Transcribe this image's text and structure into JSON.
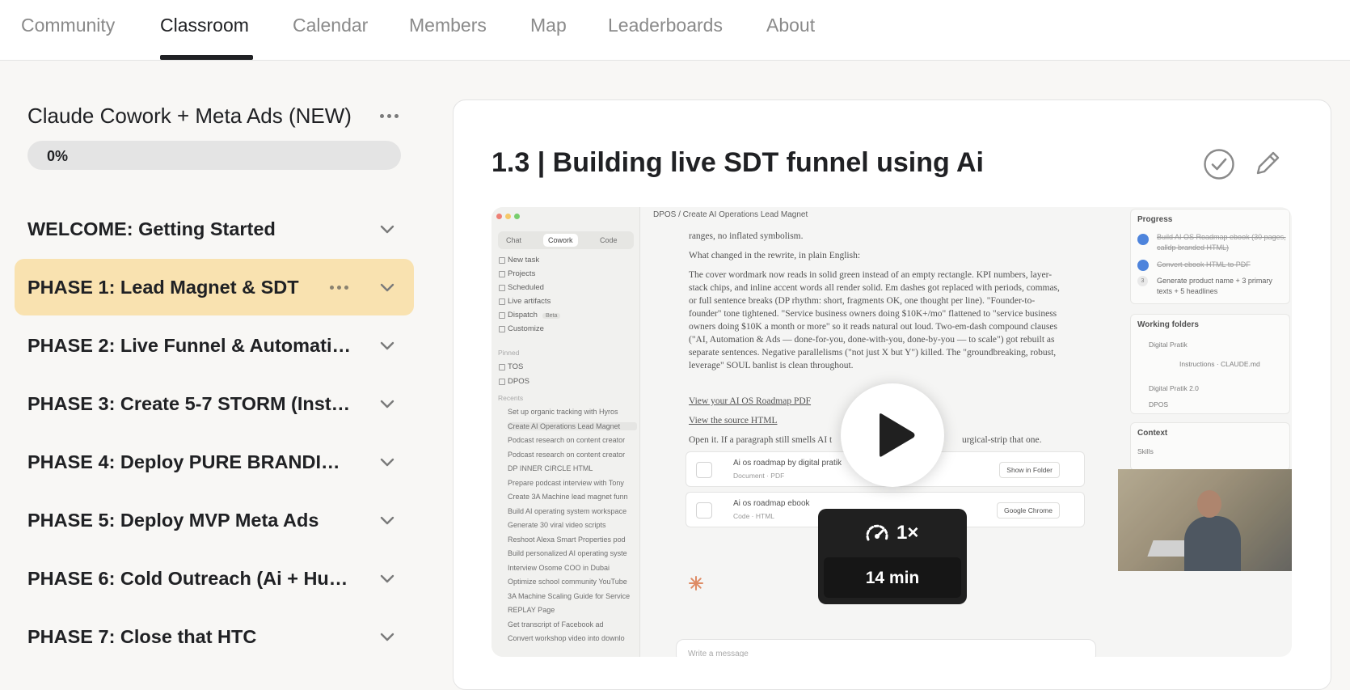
{
  "nav": {
    "tabs": [
      "Community",
      "Classroom",
      "Calendar",
      "Members",
      "Map",
      "Leaderboards",
      "About"
    ],
    "active": "Classroom"
  },
  "sidebar": {
    "course_title": "Claude Cowork + Meta Ads (NEW)",
    "progress_text": "0%",
    "progress_value": 0,
    "phases": [
      "WELCOME: Getting Started",
      "PHASE 1: Lead Magnet & SDT",
      "PHASE 2: Live Funnel & Automations",
      "PHASE 3: Create 5-7 STORM (Insta...",
      "PHASE 4: Deploy PURE BRANDING ...",
      "PHASE 5: Deploy MVP Meta Ads",
      "PHASE 6: Cold Outreach (Ai + Hum...",
      "PHASE 7: Close that HTC"
    ],
    "active_phase_index": 1
  },
  "lesson": {
    "title": "1.3 | Building live SDT funnel using Ai"
  },
  "video": {
    "speed": "1×",
    "duration": "14 min",
    "app": {
      "segments": [
        "Chat",
        "Cowork",
        "Code"
      ],
      "menu": [
        "New task",
        "Projects",
        "Scheduled",
        "Live artifacts",
        "Dispatch",
        "Customize"
      ],
      "beta": "Beta",
      "pinned_label": "Pinned",
      "pinned": [
        "TOS",
        "DPOS"
      ],
      "recents_label": "Recents",
      "recents": [
        "Set up organic tracking with Hyros",
        "Create AI Operations Lead Magnet",
        "Podcast research on content creator",
        "Podcast research on content creator",
        "DP INNER CIRCLE HTML",
        "Prepare podcast interview with Tony",
        "Create 3A Machine lead magnet funn",
        "Build AI operating system workspace",
        "Generate 30 viral video scripts",
        "Reshoot Alexa Smart Properties pod",
        "Build personalized AI operating syste",
        "Interview Osome COO in Dubai",
        "Optimize school community YouTube",
        "3A Machine Scaling Guide for Service",
        "REPLAY Page",
        "Get transcript of Facebook ad",
        "Convert workshop video into downlo"
      ],
      "breadcrumb": "DPOS  /  Create AI Operations Lead Magnet",
      "text_top": "ranges, no inflated symbolism.",
      "text_heading": "What changed in the rewrite, in plain English:",
      "text_body": "The cover wordmark now reads in solid green instead of an empty rectangle. KPI numbers, layer-stack chips, and inline accent words all render solid. Em dashes got replaced with periods, commas, or full sentence breaks (DP rhythm: short, fragments OK, one thought per line). \"Founder-to-founder\" tone tightened. \"Service business owners doing $10K+/mo\" flattened to \"service business owners doing $10K a month or more\" so it reads natural out loud. Two-em-dash compound clauses (\"AI, Automation & Ads — done-for-you, done-with-you, done-by-you — to scale\") got rebuilt as separate sentences. Negative parallelisms (\"not just X but Y\") killed. The \"groundbreaking, robust, leverage\" SOUL banlist is clean throughout.",
      "link1": "View your AI OS Roadmap PDF",
      "link2": "View the source HTML",
      "text_open": "Open it. If a paragraph still smells AI t",
      "text_open_tail": "urgical-strip that one.",
      "files": [
        {
          "name": "Ai os roadmap by digital pratik",
          "meta": "Document · PDF",
          "action": "Show in Folder"
        },
        {
          "name": "Ai os roadmap ebook",
          "meta": "Code · HTML",
          "action": "Google Chrome"
        }
      ],
      "input_placeholder": "Write a message",
      "progress_title": "Progress",
      "tasks": [
        {
          "text": "Build AI OS Roadmap ebook (30 pages, calldp branded HTML)",
          "done": true
        },
        {
          "text": "Convert ebook HTML to PDF",
          "done": true
        },
        {
          "text": "Generate product name + 3 primary texts + 5 headlines",
          "done": false,
          "num": "3"
        }
      ],
      "folders_title": "Working folders",
      "folders": [
        "Digital Pratik",
        "Instructions · CLAUDE.md",
        "Digital Pratik 2.0",
        "DPOS"
      ],
      "context_title": "Context",
      "skills_label": "Skills"
    }
  },
  "colors": {
    "active_phase_bg": "#f9e2b0",
    "text": "#202124",
    "muted_tab": "#8a8a8a",
    "accent_check": "#2f6fd6"
  }
}
